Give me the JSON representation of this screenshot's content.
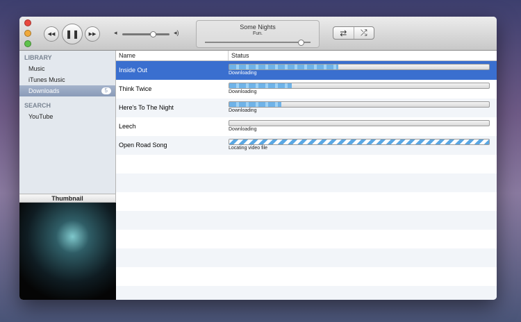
{
  "player": {
    "song": "Some Nights",
    "artist": "Fun.",
    "volume_fraction": 0.65,
    "position_fraction": 0.91
  },
  "toolbar": {
    "rewind": "◀◀",
    "pause": "❚❚",
    "forward": "▶▶",
    "repeat": "⇄",
    "shuffle": "⤮",
    "vol_low": "◂",
    "vol_high": "◂)"
  },
  "sidebar": {
    "library_header": "LIBRARY",
    "items": [
      {
        "label": "Music"
      },
      {
        "label": "iTunes Music"
      },
      {
        "label": "Downloads",
        "badge": "5"
      }
    ],
    "search_header": "SEARCH",
    "search_items": [
      {
        "label": "YouTube"
      }
    ]
  },
  "thumbnail": {
    "header": "Thumbnail"
  },
  "table": {
    "columns": [
      "Name",
      "Status"
    ],
    "rows": [
      {
        "name": "Inside Out",
        "status": "Downloading",
        "progress": 0.42
      },
      {
        "name": "Think Twice",
        "status": "Downloading",
        "progress": 0.24
      },
      {
        "name": "Here's To The Night",
        "status": "Downloading",
        "progress": 0.2
      },
      {
        "name": "Leech",
        "status": "Downloading",
        "progress": 0
      },
      {
        "name": "Open Road Song",
        "status": "Locating video file",
        "progress": null
      }
    ]
  }
}
